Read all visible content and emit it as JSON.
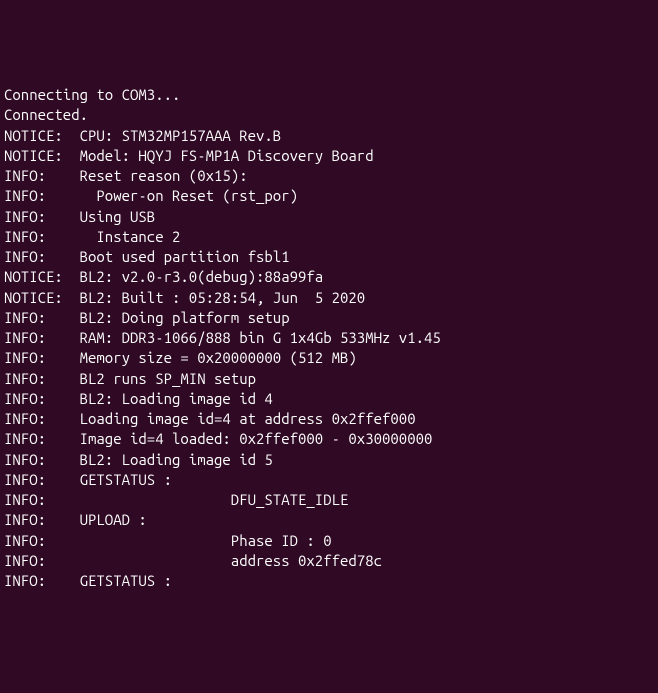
{
  "lines": [
    "Connecting to COM3...",
    "Connected.",
    "",
    "NOTICE:  CPU: STM32MP157AAA Rev.B",
    "NOTICE:  Model: HQYJ FS-MP1A Discovery Board",
    "INFO:    Reset reason (0x15):",
    "INFO:      Power-on Reset (rst_por)",
    "INFO:    Using USB",
    "INFO:      Instance 2",
    "INFO:    Boot used partition fsbl1",
    "NOTICE:  BL2: v2.0-r3.0(debug):88a99fa",
    "NOTICE:  BL2: Built : 05:28:54, Jun  5 2020",
    "INFO:    BL2: Doing platform setup",
    "INFO:    RAM: DDR3-1066/888 bin G 1x4Gb 533MHz v1.45",
    "INFO:    Memory size = 0x20000000 (512 MB)",
    "INFO:    BL2 runs SP_MIN setup",
    "INFO:    BL2: Loading image id 4",
    "INFO:    Loading image id=4 at address 0x2ffef000",
    "INFO:    Image id=4 loaded: 0x2ffef000 - 0x30000000",
    "INFO:    BL2: Loading image id 5",
    "INFO:    GETSTATUS :",
    "INFO:                      DFU_STATE_IDLE",
    "INFO:    UPLOAD :",
    "INFO:                      Phase ID : 0",
    "INFO:                      address 0x2ffed78c",
    "INFO:    GETSTATUS :"
  ]
}
